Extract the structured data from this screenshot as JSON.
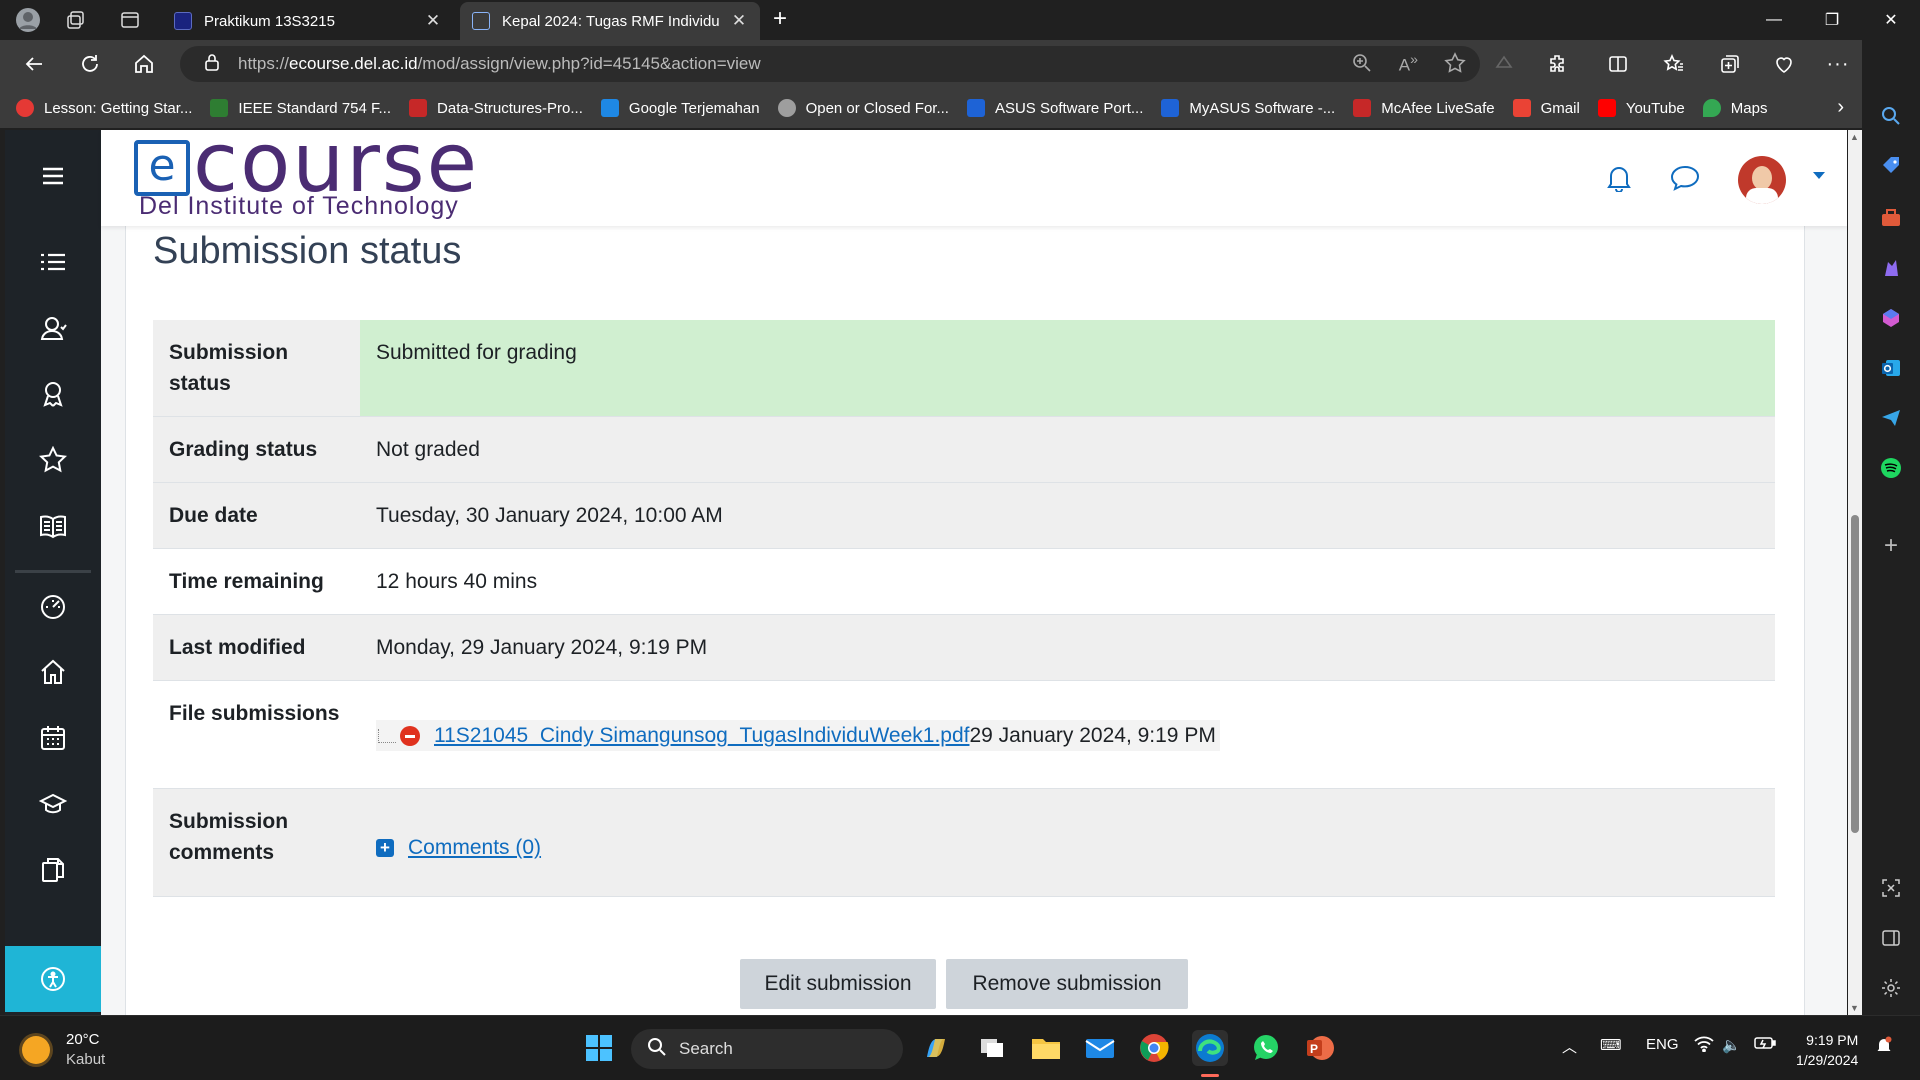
{
  "browser": {
    "tabs": [
      {
        "title": "Praktikum 13S3215",
        "active": false
      },
      {
        "title": "Kepal 2024: Tugas RMF Individu",
        "active": true
      }
    ],
    "url_prefix": "https://",
    "url_host": "ecourse.del.ac.id",
    "url_path": "/mod/assign/view.php?id=45145&action=view",
    "bookmarks": [
      {
        "label": "Lesson: Getting Star...",
        "color": "#e53935"
      },
      {
        "label": "IEEE Standard 754 F...",
        "color": "#2e7d32"
      },
      {
        "label": "Data-Structures-Pro...",
        "color": "#c62828"
      },
      {
        "label": "Google Terjemahan",
        "color": "#1e88e5"
      },
      {
        "label": "Open or Closed For...",
        "color": "#9e9e9e"
      },
      {
        "label": "ASUS Software Port...",
        "color": "#1e63d6"
      },
      {
        "label": "MyASUS Software -...",
        "color": "#1e63d6"
      },
      {
        "label": "McAfee LiveSafe",
        "color": "#c62828"
      },
      {
        "label": "Gmail",
        "color": "#ea4335"
      },
      {
        "label": "YouTube",
        "color": "#ff0000"
      },
      {
        "label": "Maps",
        "color": "#34a853"
      }
    ]
  },
  "site": {
    "logo_word": "course",
    "logo_letter": "e",
    "logo_subtitle": "Del Institute of Technology"
  },
  "main": {
    "section_title": "Submission status",
    "rows": [
      {
        "label": "Submission status",
        "value": "Submitted for grading"
      },
      {
        "label": "Grading status",
        "value": "Not graded"
      },
      {
        "label": "Due date",
        "value": "Tuesday, 30 January 2024, 10:00 AM"
      },
      {
        "label": "Time remaining",
        "value": "12 hours 40 mins"
      },
      {
        "label": "Last modified",
        "value": "Monday, 29 January 2024, 9:19 PM"
      }
    ],
    "file_submissions": {
      "label": "File submissions",
      "filename": "11S21045_Cindy Simangunsog_TugasIndividuWeek1.pdf",
      "timestamp": "29 January 2024, 9:19 PM"
    },
    "comments": {
      "label": "Submission comments",
      "link": "Comments (0)"
    },
    "buttons": {
      "edit": "Edit submission",
      "remove": "Remove submission"
    }
  },
  "taskbar": {
    "temperature": "20°C",
    "weather_desc": "Kabut",
    "search_label": "Search",
    "language": "ENG",
    "time": "9:19 PM",
    "date": "1/29/2024"
  },
  "colors": {
    "accent": "#0f6cbf",
    "brand_purple": "#4b2c73",
    "success_bg": "#d0efd0",
    "nav_dark": "#1e2328",
    "access_cyan": "#1fb5d6"
  }
}
